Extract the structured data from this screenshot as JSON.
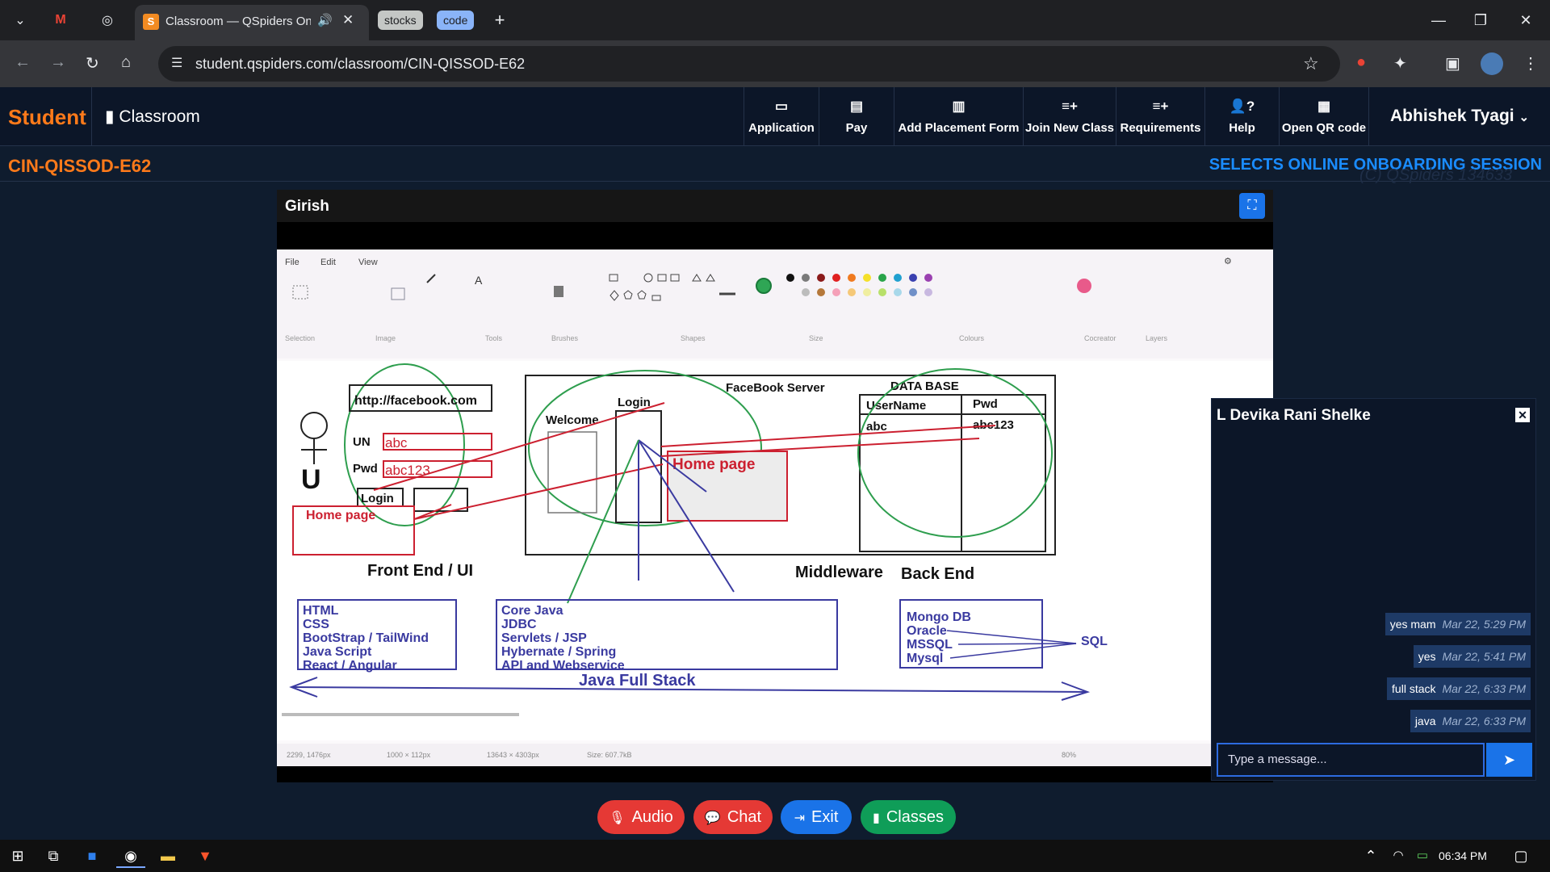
{
  "browser": {
    "active_tab_title": "Classroom — QSpiders Onl",
    "group_tabs": [
      "stocks",
      "code"
    ],
    "url": "student.qspiders.com/classroom/CIN-QISSOD-E62"
  },
  "header": {
    "brand": "Student",
    "section": "Classroom",
    "nav": [
      {
        "label": "Application",
        "icon": "application-icon"
      },
      {
        "label": "Pay",
        "icon": "pay-icon"
      },
      {
        "label": "Add Placement Form",
        "icon": "placement-form-icon"
      },
      {
        "label": "Join New Class",
        "icon": "join-class-icon"
      },
      {
        "label": "Requirements",
        "icon": "requirements-icon"
      },
      {
        "label": "Help",
        "icon": "help-icon"
      },
      {
        "label": "Open QR code",
        "icon": "qr-code-icon"
      }
    ],
    "user_name": "Abhishek Tyagi"
  },
  "subheader": {
    "class_code": "CIN-QISSOD-E62",
    "session_title": "SELECTS ONLINE ONBOARDING SESSION",
    "watermark": "(C) QSpiders 134633"
  },
  "video": {
    "presenter": "Girish",
    "paint_menu": [
      "File",
      "Edit",
      "View"
    ],
    "ribbon_groups": [
      "Selection",
      "Image",
      "Tools",
      "Brushes",
      "Shapes",
      "Size",
      "Colours",
      "Cocreator",
      "Layers"
    ],
    "status": {
      "cursor": "2299, 1476px",
      "selection": "1000 × 112px",
      "canvas_size": "13643 × 4303px",
      "file_size": "Size: 607.7kB",
      "zoom": "80%"
    },
    "whiteboard": {
      "url_box": "http://facebook.com",
      "un_label": "UN",
      "un_value": "abc",
      "pwd_label": "Pwd",
      "pwd_value": "abc123",
      "login_btn": "Login",
      "home_page_left": "Home page",
      "user_letter": "U",
      "server_title": "FaceBook Server",
      "welcome": "Welcome",
      "login_server": "Login",
      "home_page_server": "Home page",
      "db_title": "DATA BASE",
      "db_headers": [
        "UserName",
        "Pwd"
      ],
      "db_row": [
        "abc",
        "abc123"
      ],
      "label_front": "Front End / UI",
      "label_middle": "Middleware",
      "label_back": "Back End",
      "front_stack": [
        "HTML",
        "CSS",
        "BootStrap / TailWind",
        "Java Script",
        "React / Angular"
      ],
      "middle_stack": [
        "Core Java",
        "JDBC",
        "Servlets / JSP",
        "Hybernate / Spring",
        "API and Webservice"
      ],
      "back_stack": [
        "Mongo DB",
        "Oracle",
        "MSSQL",
        "Mysql"
      ],
      "sql_label": "SQL",
      "full_stack": "Java  Full Stack"
    }
  },
  "chat": {
    "title": "L Devika Rani Shelke",
    "messages": [
      {
        "text": "yes mam",
        "time": "Mar 22, 5:29 PM"
      },
      {
        "text": "yes",
        "time": "Mar 22, 5:41 PM"
      },
      {
        "text": "full stack",
        "time": "Mar 22, 6:33 PM"
      },
      {
        "text": "java",
        "time": "Mar 22, 6:33 PM"
      }
    ],
    "input_placeholder": "Type a message..."
  },
  "controls": [
    {
      "label": "Audio",
      "color": "#e53935"
    },
    {
      "label": "Chat",
      "color": "#e53935"
    },
    {
      "label": "Exit",
      "color": "#1a73e8"
    },
    {
      "label": "Classes",
      "color": "#0f9d58"
    }
  ],
  "taskbar": {
    "time": "06:34 PM"
  }
}
